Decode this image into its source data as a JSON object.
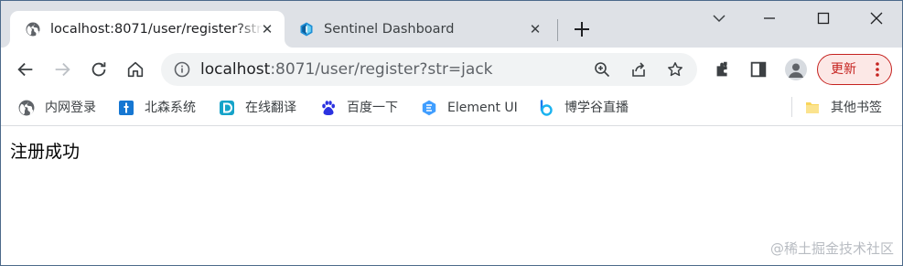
{
  "tabs": [
    {
      "title": "localhost:8071/user/register?str=jack",
      "icon": "globe-icon",
      "active": true
    },
    {
      "title": "Sentinel Dashboard",
      "icon": "sentinel-icon",
      "active": false
    }
  ],
  "window_controls": [
    "tab-search-icon",
    "minimize-icon",
    "maximize-icon",
    "close-window-icon"
  ],
  "toolbar": {
    "buttons": [
      "back-icon",
      "forward-icon",
      "reload-icon",
      "home-icon"
    ],
    "url_host": "localhost",
    "url_rest": ":8071/user/register?str=jack",
    "omnibox_icons": [
      "zoom-icon",
      "share-icon",
      "star-icon"
    ],
    "right_icons": [
      "extensions-icon",
      "side-panel-icon",
      "profile-icon"
    ],
    "update_label": "更新",
    "accent": "#c5221f"
  },
  "bookmarks": [
    {
      "label": "内网登录",
      "icon": "globe-icon"
    },
    {
      "label": "北森系统",
      "icon": "beisen-icon"
    },
    {
      "label": "在线翻译",
      "icon": "translate-icon"
    },
    {
      "label": "百度一下",
      "icon": "baidu-icon"
    },
    {
      "label": "Element UI",
      "icon": "element-icon"
    },
    {
      "label": "博学谷直播",
      "icon": "boxuegu-icon"
    }
  ],
  "other_bookmarks": {
    "label": "其他书签",
    "icon": "folder-icon"
  },
  "page": {
    "message": "注册成功"
  },
  "watermark": "@稀土掘金技术社区"
}
